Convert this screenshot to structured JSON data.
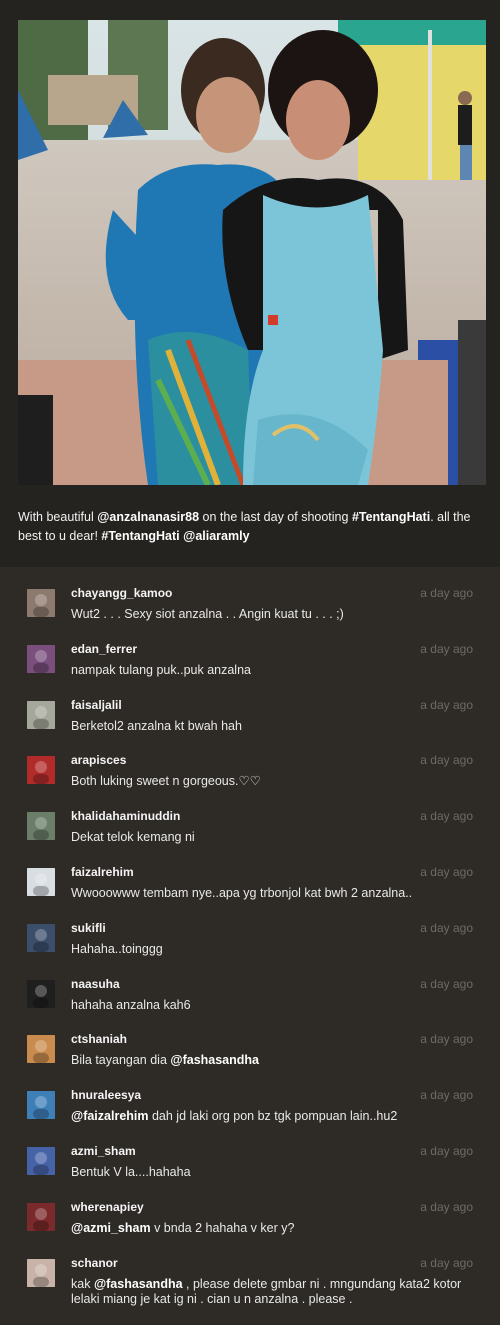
{
  "caption": {
    "prefix": "With beautiful ",
    "mention1": "@anzalnanasir88",
    "middle": " on the last day of shooting ",
    "hashtag1": "#TentangHati",
    "middle2": ". all the best to u dear! ",
    "hashtag2": "#TentangHati",
    "space": " ",
    "mention2": "@aliaramly"
  },
  "comments": [
    {
      "username": "chayangg_kamoo",
      "time": "a day ago",
      "text": "Wut2 . . . Sexy siot anzalna . . Angin kuat tu . . . ;)",
      "avatar_color": "#8c7a6e"
    },
    {
      "username": "edan_ferrer",
      "time": "a day ago",
      "text": "nampak tulang puk..puk anzalna",
      "avatar_color": "#7a4f7d"
    },
    {
      "username": "faisaljalil",
      "time": "a day ago",
      "text": "Berketol2 anzalna kt bwah hah",
      "avatar_color": "#a4a79a"
    },
    {
      "username": "arapisces",
      "time": "a day ago",
      "text": "Both luking sweet n gorgeous.♡♡",
      "avatar_color": "#b22b2b"
    },
    {
      "username": "khalidahaminuddin",
      "time": "a day ago",
      "text": "Dekat telok kemang ni",
      "avatar_color": "#6a7e6a"
    },
    {
      "username": "faizalrehim",
      "time": "a day ago",
      "text": "Wwooowww tembam nye..apa yg trbonjol kat bwh 2 anzalna..",
      "avatar_color": "#d9dee3"
    },
    {
      "username": "sukifli",
      "time": "a day ago",
      "text": "Hahaha..toinggg",
      "avatar_color": "#3b4f6a"
    },
    {
      "username": "naasuha",
      "time": "a day ago",
      "text": "hahaha anzalna kah6",
      "avatar_color": "#1f1f1f"
    },
    {
      "username": "ctshaniah",
      "time": "a day ago",
      "text": "Bila tayangan dia ",
      "mention": "@fashasandha",
      "avatar_color": "#c98b4e"
    },
    {
      "username": "hnuraleesya",
      "time": "a day ago",
      "mention_first": "@faizalrehim",
      "text": " dah jd laki org pon bz tgk pompuan lain..hu2",
      "avatar_color": "#3f7fb8"
    },
    {
      "username": "azmi_sham",
      "time": "a day ago",
      "text": "Bentuk V la....hahaha",
      "avatar_color": "#4763a8"
    },
    {
      "username": "wherenapiey",
      "time": "a day ago",
      "mention_first": "@azmi_sham",
      "text": " v bnda 2 hahaha v ker y?",
      "avatar_color": "#7a2a2a"
    },
    {
      "username": "schanor",
      "time": "a day ago",
      "text_pre": "kak ",
      "mention": "@fashasandha",
      "text": " , please delete gmbar ni . mngundang kata2 kotor lelaki miang je kat ig ni . cian u n anzalna . please .",
      "avatar_color": "#c9b3a8"
    }
  ]
}
